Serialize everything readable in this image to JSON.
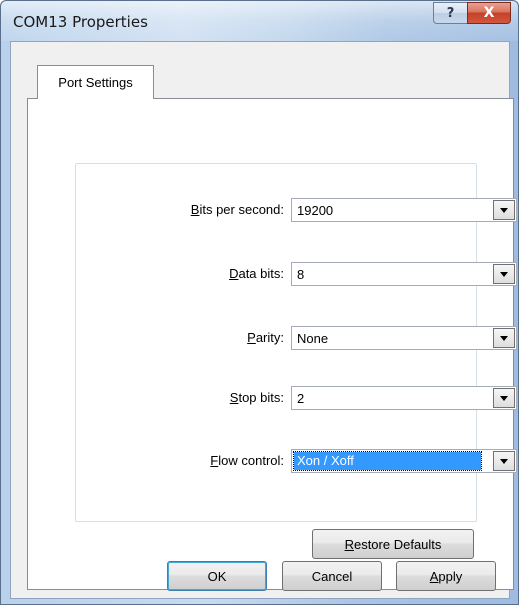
{
  "window": {
    "title": "COM13 Properties",
    "help_glyph": "?",
    "close_glyph": "X"
  },
  "tabs": [
    {
      "label": "Port Settings",
      "selected": true
    }
  ],
  "fields": {
    "bits_per_second": {
      "mnemonic": "B",
      "rest": "its per second:",
      "value": "19200"
    },
    "data_bits": {
      "mnemonic": "D",
      "rest": "ata bits:",
      "value": "8"
    },
    "parity": {
      "mnemonic": "P",
      "rest": "arity:",
      "value": "None"
    },
    "stop_bits": {
      "mnemonic": "S",
      "rest": "top bits:",
      "value": "2"
    },
    "flow_control": {
      "mnemonic": "F",
      "rest": "low control:",
      "value": "Xon / Xoff",
      "focused": true
    }
  },
  "buttons": {
    "restore_mnemonic": "R",
    "restore_rest": "estore Defaults",
    "ok": "OK",
    "cancel": "Cancel",
    "apply_mnemonic": "A",
    "apply_rest": "pply"
  },
  "colors": {
    "selection": "#3399ff",
    "close_button": "#c4412a"
  },
  "icons": {
    "dropdown": "chevron-down-icon",
    "help": "question-mark-icon",
    "close": "close-icon"
  }
}
